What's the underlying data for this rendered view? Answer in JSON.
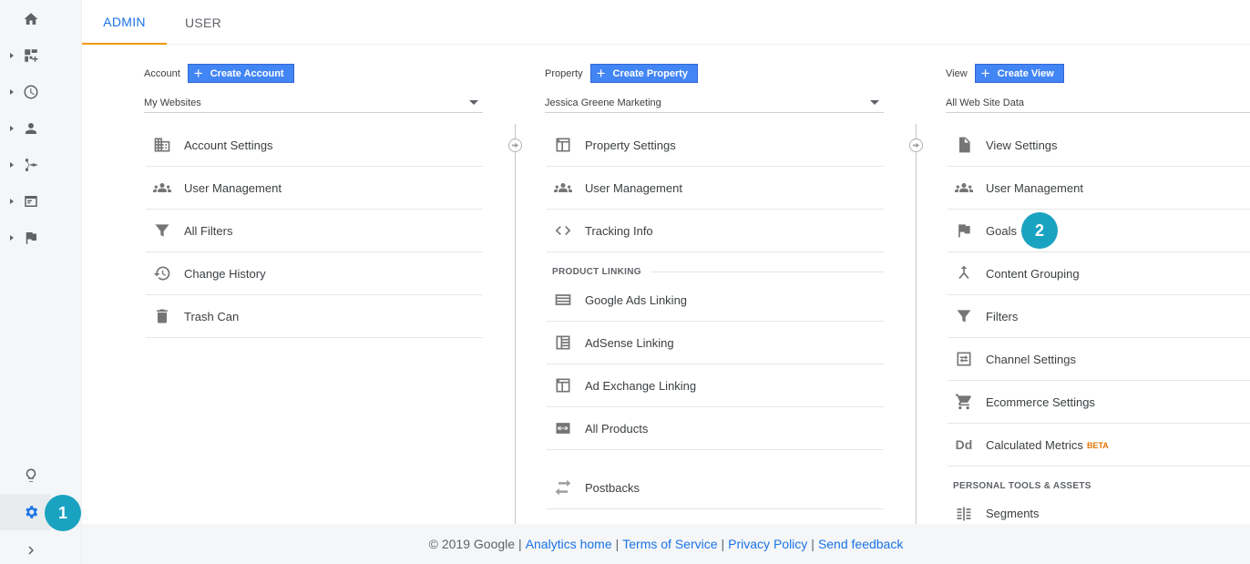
{
  "tabs": {
    "admin": "ADMIN",
    "user": "USER"
  },
  "account": {
    "label": "Account",
    "create": "Create Account",
    "selected": "My Websites",
    "items": [
      "Account Settings",
      "User Management",
      "All Filters",
      "Change History",
      "Trash Can"
    ]
  },
  "property": {
    "label": "Property",
    "create": "Create Property",
    "selected": "Jessica Greene Marketing",
    "items": [
      "Property Settings",
      "User Management",
      "Tracking Info"
    ],
    "section": "PRODUCT LINKING",
    "linking": [
      "Google Ads Linking",
      "AdSense Linking",
      "Ad Exchange Linking",
      "All Products",
      "Postbacks"
    ]
  },
  "view": {
    "label": "View",
    "create": "Create View",
    "selected": "All Web Site Data",
    "items": [
      "View Settings",
      "User Management",
      "Goals",
      "Content Grouping",
      "Filters",
      "Channel Settings",
      "Ecommerce Settings",
      "Calculated Metrics"
    ],
    "beta": "BETA",
    "section": "PERSONAL TOOLS & ASSETS",
    "tools": [
      "Segments"
    ]
  },
  "badges": {
    "one": "1",
    "two": "2"
  },
  "footer": {
    "copyright": "© 2019 Google",
    "links": [
      "Analytics home",
      "Terms of Service",
      "Privacy Policy",
      "Send feedback"
    ]
  },
  "colors": {
    "accent": "#1a73e8",
    "badge": "#1aa3c1",
    "tab_underline": "#f29900",
    "button": "#4285f4"
  },
  "icons": {
    "nav": [
      "home-icon",
      "customization-icon",
      "realtime-icon",
      "audience-icon",
      "acquisition-icon",
      "behavior-icon",
      "conversions-icon",
      "lightbulb-icon",
      "gear-icon",
      "chevron-right-icon"
    ]
  }
}
